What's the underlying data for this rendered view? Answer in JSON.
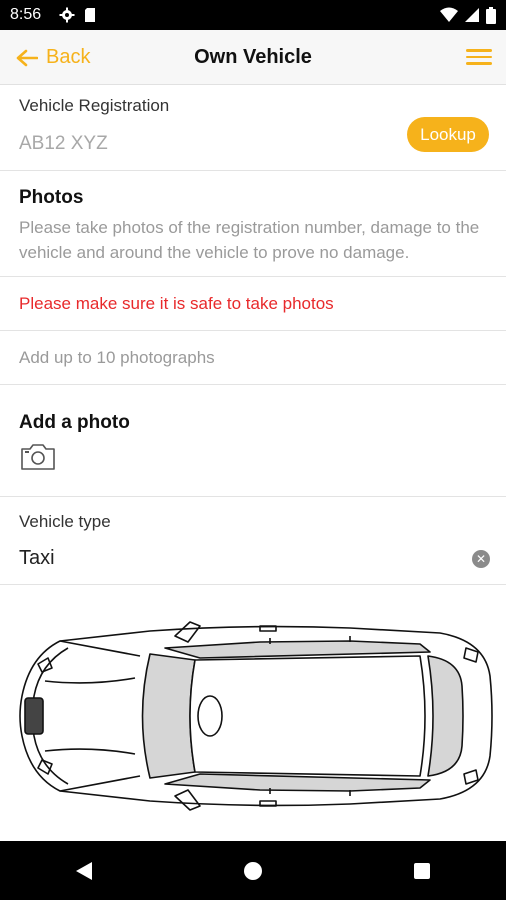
{
  "status_bar": {
    "time": "8:56"
  },
  "app_bar": {
    "back_label": "Back",
    "title": "Own Vehicle"
  },
  "registration": {
    "label": "Vehicle Registration",
    "placeholder": "AB12 XYZ",
    "lookup_label": "Lookup"
  },
  "photos": {
    "heading": "Photos",
    "description": "Please take photos of the registration number, damage to the vehicle and around the vehicle to prove no damage.",
    "warning": "Please make sure it is safe to take photos",
    "limit": "Add up to 10 photographs"
  },
  "add_photo": {
    "heading": "Add a photo"
  },
  "vehicle_type": {
    "label": "Vehicle type",
    "value": "Taxi"
  },
  "colors": {
    "accent": "#f6b21b",
    "warning": "#e8292b",
    "muted": "#9a9a9a"
  }
}
